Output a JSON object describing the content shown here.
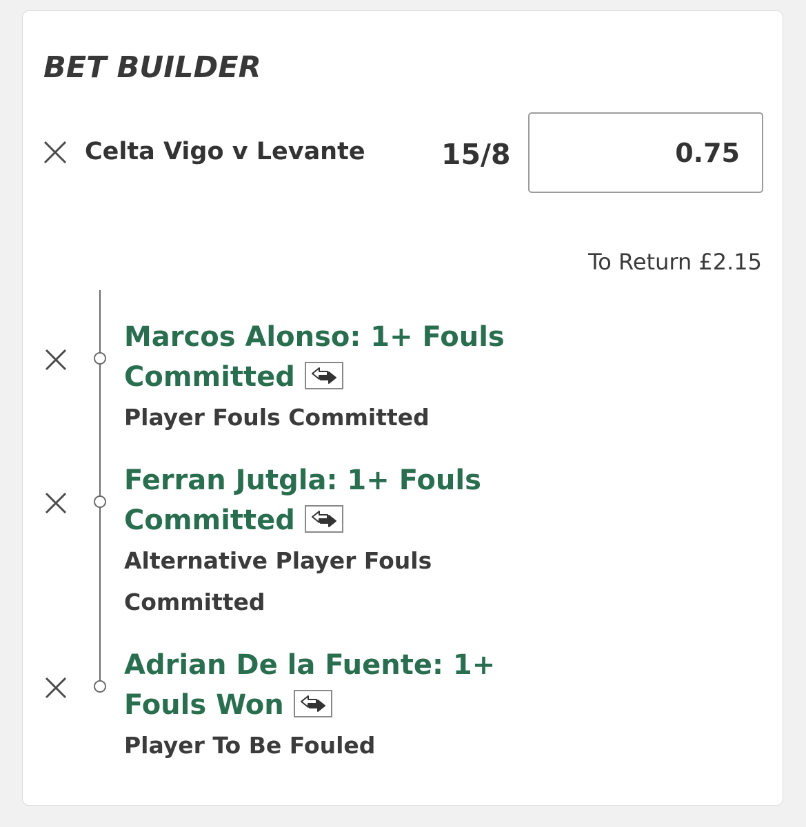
{
  "header": {
    "title": "BET BUILDER"
  },
  "bet": {
    "match": "Celta Vigo v Levante",
    "odds": "15/8",
    "stake": "0.75",
    "to_return": "To Return £2.15"
  },
  "legs": [
    {
      "selection": "Marcos Alonso: 1+ Fouls Committed",
      "market": "Player Fouls Committed"
    },
    {
      "selection": "Ferran Jutgla: 1+ Fouls Committed",
      "market": "Alternative Player Fouls Committed"
    },
    {
      "selection": "Adrian De la Fuente: 1+ Fouls Won",
      "market": "Player To Be Fouled"
    }
  ],
  "icons": {
    "remove": "close-icon",
    "swap": "swap-icon"
  },
  "colors": {
    "selection_green": "#2a6e50",
    "text_dark": "#333333",
    "border_grey": "#9c9c9c"
  }
}
